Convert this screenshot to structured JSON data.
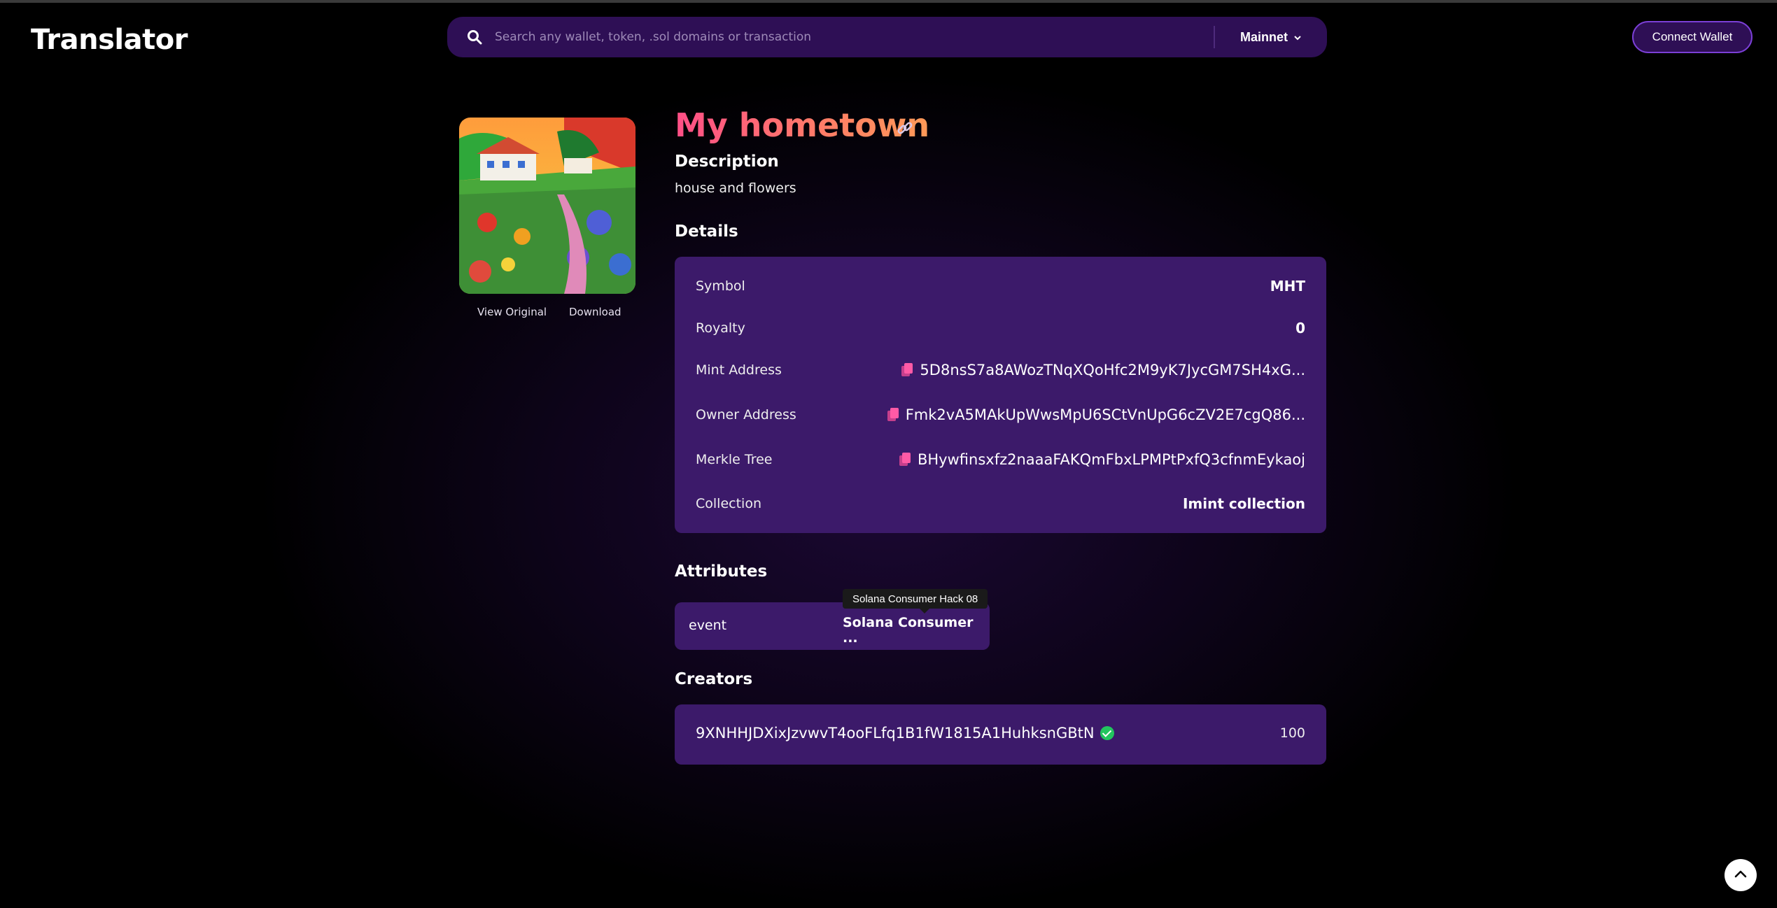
{
  "header": {
    "logo": "Translator",
    "search_placeholder": "Search any wallet, token, .sol domains or transaction",
    "network": "Mainnet",
    "connect_label": "Connect Wallet"
  },
  "nft": {
    "title": "My hometown",
    "view_original": "View Original",
    "download": "Download"
  },
  "description": {
    "heading": "Description",
    "text": "house and flowers"
  },
  "details": {
    "heading": "Details",
    "rows": [
      {
        "label": "Symbol",
        "value": "MHT"
      },
      {
        "label": "Royalty",
        "value": "0"
      },
      {
        "label": "Mint Address",
        "value": "5D8nsS7a8AWozTNqXQoHfc2M9yK7JycGM7SH4xG..."
      },
      {
        "label": "Owner Address",
        "value": "Fmk2vA5MAkUpWwsMpU6SCtVnUpG6cZV2E7cgQ86..."
      },
      {
        "label": "Merkle Tree",
        "value": "BHywfinsxfz2naaaFAKQmFbxLPMPtPxfQ3cfnmEykaoj"
      },
      {
        "label": "Collection",
        "value": "Imint collection"
      }
    ]
  },
  "attributes": {
    "heading": "Attributes",
    "items": [
      {
        "key": "event",
        "value": "Solana Consumer ...",
        "tooltip": "Solana Consumer Hack 08"
      }
    ]
  },
  "creators": {
    "heading": "Creators",
    "items": [
      {
        "address": "9XNHHJDXixJzvwvT4ooFLfq1B1fW1815A1HuhksnGBtN",
        "share": "100"
      }
    ]
  },
  "icons": [
    "search-icon",
    "chevron-down-icon",
    "link-icon",
    "copy-icon",
    "verified-icon",
    "chevron-up-icon"
  ],
  "colors": {
    "accent": "#ff4f87",
    "card": "#3c1a6a",
    "search_bg": "#2e0f55",
    "verified": "#22c55e"
  }
}
